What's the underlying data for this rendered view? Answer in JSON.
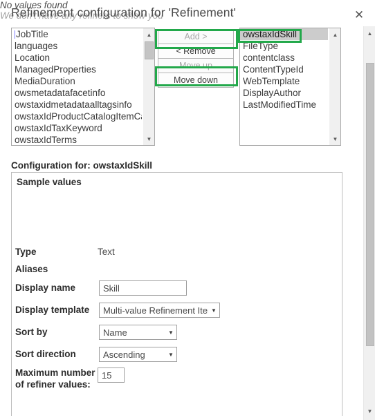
{
  "dialog": {
    "title": "Refinement configuration for 'Refinement'",
    "close_label": "✕"
  },
  "available_list": {
    "items": [
      "JobTitle",
      "languages",
      "Location",
      "ManagedProperties",
      "MediaDuration",
      "owsmetadatafacetinfo",
      "owstaxidmetadataalltagsinfo",
      "owstaxIdProductCatalogItemCate",
      "owstaxIdTaxKeyword",
      "owstaxIdTerms"
    ]
  },
  "selected_list": {
    "items": [
      "owstaxIdSkill",
      "FileType",
      "contentclass",
      "ContentTypeId",
      "WebTemplate",
      "DisplayAuthor",
      "LastModifiedTime"
    ],
    "selected": "owstaxIdSkill"
  },
  "buttons": {
    "add": "Add >",
    "remove": "< Remove",
    "move_up": "Move up",
    "move_down": "Move down"
  },
  "configuration": {
    "header": "Configuration for: owstaxIdSkill",
    "sample_values_label": "Sample values",
    "sample_values_primary": "No values found",
    "sample_values_secondary": "We don't have any refiners to show you",
    "type_label": "Type",
    "type_value": "Text",
    "aliases_label": "Aliases",
    "aliases_value": "",
    "display_name_label": "Display name",
    "display_name_value": "Skill",
    "display_template_label": "Display template",
    "display_template_value": "Multi-value Refinement Item",
    "sort_by_label": "Sort by",
    "sort_by_value": "Name",
    "sort_direction_label": "Sort direction",
    "sort_direction_value": "Ascending",
    "max_values_label": "Maximum number of refiner values:",
    "max_values_value": "15"
  },
  "icons": {
    "scroll_up": "▲",
    "scroll_down": "▼",
    "select_caret": "▼"
  },
  "colors": {
    "highlight_green": "#22a84a",
    "selection_gray": "#cccccc"
  }
}
